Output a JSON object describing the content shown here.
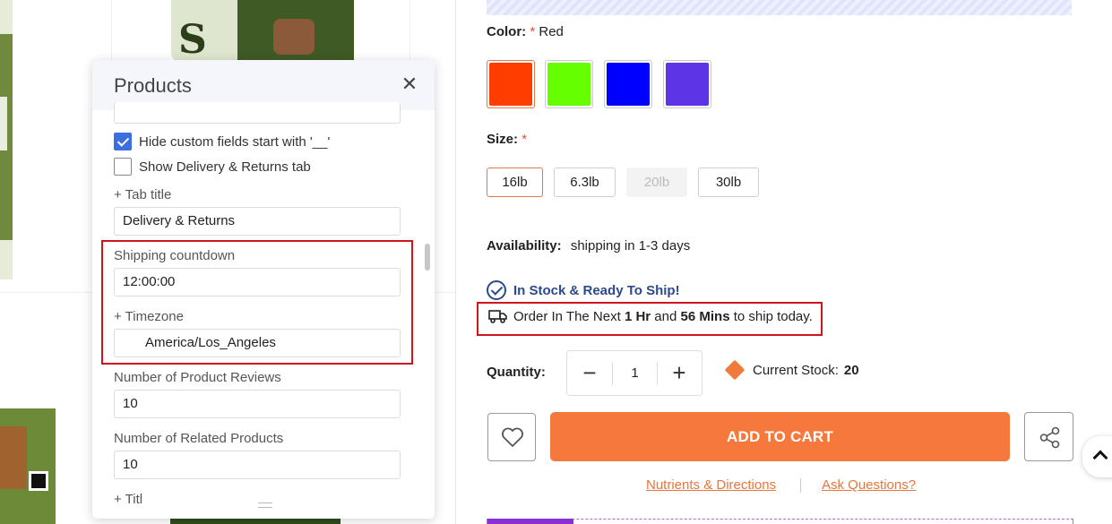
{
  "panel": {
    "title": "Products",
    "close_icon": "close-icon",
    "hide_custom_label": "Hide custom fields start with '__'",
    "hide_custom_checked": true,
    "show_delivery_label": "Show Delivery & Returns tab",
    "show_delivery_checked": false,
    "tab_title_label": "+ Tab title",
    "tab_title_value": "Delivery & Returns",
    "shipping_countdown_label": "Shipping countdown",
    "shipping_countdown_value": "12:00:00",
    "timezone_label": "+ Timezone",
    "timezone_value": "America/Los_Angeles",
    "reviews_label": "Number of Product Reviews",
    "reviews_value": "10",
    "related_label": "Number of Related Products",
    "related_value": "10",
    "partial_label": "+ Titl"
  },
  "product": {
    "color_label": "Color:",
    "color_required": "*",
    "color_value": "Red",
    "colors": [
      "#ff3d00",
      "#66ff00",
      "#0000ff",
      "#5e35e6"
    ],
    "size_label": "Size:",
    "size_required": "*",
    "sizes": [
      "16lb",
      "6.3lb",
      "20lb",
      "30lb"
    ],
    "availability_label": "Availability:",
    "availability_value": "shipping in 1-3 days",
    "in_stock_text": "In Stock & Ready To Ship!",
    "order_prefix": "Order In The Next ",
    "order_hours": "1 Hr",
    "order_mid": " and ",
    "order_mins": "56 Mins",
    "order_suffix": " to ship today.",
    "quantity_label": "Quantity:",
    "quantity_value": "1",
    "current_stock_label": "Current Stock:",
    "current_stock_value": "20",
    "add_to_cart": "ADD TO CART",
    "link_nutrients": "Nutrients & Directions",
    "link_questions": "Ask Questions?",
    "accent_color": "#f5793c",
    "highlight_color": "#d0141b"
  }
}
